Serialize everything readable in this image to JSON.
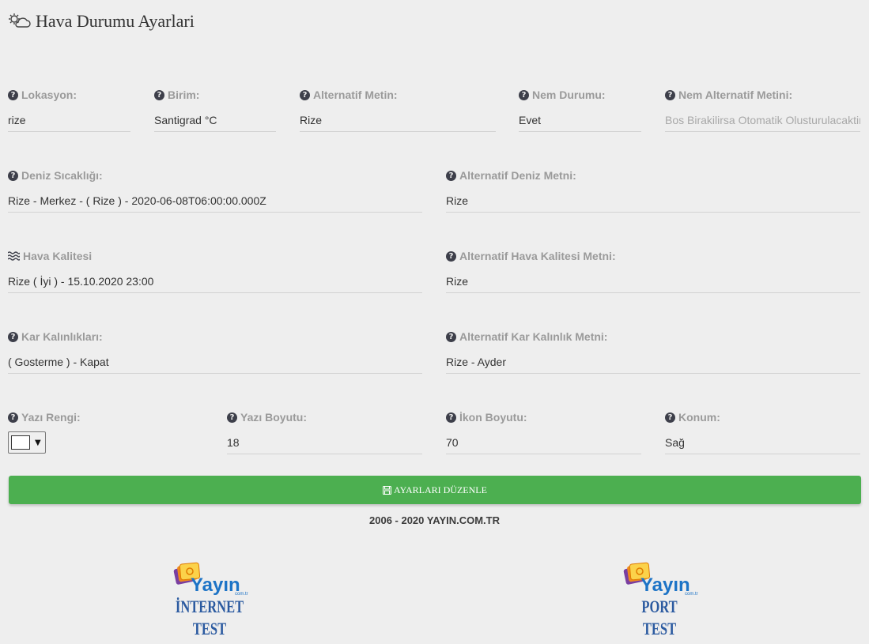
{
  "page": {
    "title": "Hava Durumu Ayarlari"
  },
  "row1": {
    "lokasyon": {
      "label": "Lokasyon:",
      "value": "rize"
    },
    "birim": {
      "label": "Birim:",
      "value": "Santigrad °C"
    },
    "alternatif_metin": {
      "label": "Alternatif Metin:",
      "value": "Rize"
    },
    "nem_durumu": {
      "label": "Nem Durumu:",
      "value": "Evet"
    },
    "nem_alternatif": {
      "label": "Nem Alternatif Metini:",
      "placeholder": "Bos Birakilirsa Otomatik Olusturulacaktir"
    }
  },
  "row2": {
    "deniz_sicakligi": {
      "label": "Deniz Sıcaklığı:",
      "value": "Rize - Merkez - ( Rize ) - 2020-06-08T06:00:00.000Z"
    },
    "alternatif_deniz": {
      "label": "Alternatif Deniz Metni:",
      "value": "Rize"
    }
  },
  "row3": {
    "hava_kalitesi": {
      "label": "Hava Kalitesi",
      "value": "Rize ( İyi ) - 15.10.2020 23:00"
    },
    "alternatif_hava": {
      "label": "Alternatif Hava Kalitesi Metni:",
      "value": "Rize"
    }
  },
  "row4": {
    "kar_kalinliklari": {
      "label": "Kar Kalınlıkları:",
      "value": "( Gosterme ) - Kapat"
    },
    "alternatif_kar": {
      "label": "Alternatif Kar Kalınlık Metni:",
      "value": "Rize - Ayder"
    }
  },
  "row5": {
    "yazi_rengi": {
      "label": "Yazı Rengi:",
      "color": "#ffffff"
    },
    "yazi_boyutu": {
      "label": "Yazı Boyutu:",
      "value": "18"
    },
    "ikon_boyutu": {
      "label": "İkon Boyutu:",
      "value": "70"
    },
    "konum": {
      "label": "Konum:",
      "value": "Sağ"
    }
  },
  "save_button": {
    "label": "AYARLARI DÜZENLE"
  },
  "footer": {
    "copyright": "2006 - 2020 YAYIN.COM.TR"
  },
  "logos": [
    {
      "brand": "Yayın",
      "caption_line1": "İNTERNET",
      "caption_line2": "TEST"
    },
    {
      "brand": "Yayın",
      "caption_line1": "PORT",
      "caption_line2": "TEST"
    }
  ],
  "colors": {
    "accent": "#4caf50",
    "label": "#9a9a9a",
    "logo_blue": "#2b5aa0"
  }
}
